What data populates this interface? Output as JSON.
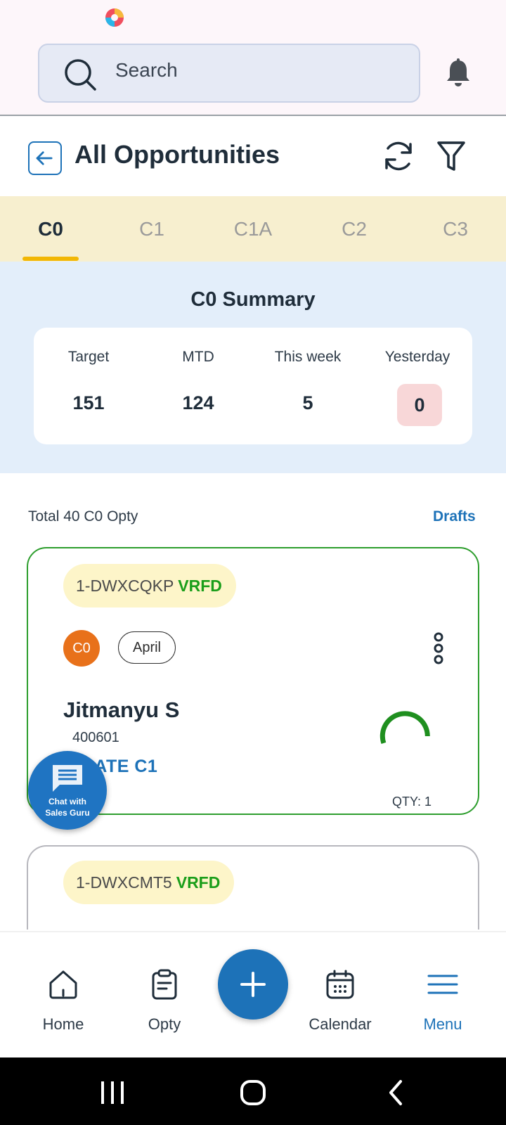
{
  "search": {
    "placeholder": "Search"
  },
  "header": {
    "title": "All Opportunities"
  },
  "tabs": [
    {
      "label": "C0",
      "active": true
    },
    {
      "label": "C1",
      "active": false
    },
    {
      "label": "C1A",
      "active": false
    },
    {
      "label": "C2",
      "active": false
    },
    {
      "label": "C3",
      "active": false
    }
  ],
  "summary": {
    "title": "C0 Summary",
    "stats": [
      {
        "label": "Target",
        "value": "151"
      },
      {
        "label": "MTD",
        "value": "124"
      },
      {
        "label": "This week",
        "value": "5"
      },
      {
        "label": "Yesterday",
        "value": "0"
      }
    ]
  },
  "list": {
    "total_label": "Total 40 C0 Opty",
    "drafts_label": "Drafts"
  },
  "cards": [
    {
      "opty_id": "1-DWXCQKP",
      "status": "VRFD",
      "stage": "C0",
      "month": "April",
      "customer": "Jitmanyu S",
      "pincode": "400601",
      "action": "UPDATE C1",
      "qty": "QTY: 1"
    },
    {
      "opty_id": "1-DWXCMT5",
      "status": "VRFD"
    }
  ],
  "chat": {
    "line1": "Chat with",
    "line2": "Sales Guru"
  },
  "nav": {
    "home": "Home",
    "opty": "Opty",
    "calendar": "Calendar",
    "menu": "Menu"
  },
  "colors": {
    "accent": "#1d72b8",
    "verified": "#1a9e1a",
    "stage_c0": "#e8711a",
    "tab_bar": "#f7efcf",
    "tab_indicator": "#f2b705",
    "summary_bg": "#e3eefa",
    "card_border_active": "#2e9e2e"
  }
}
